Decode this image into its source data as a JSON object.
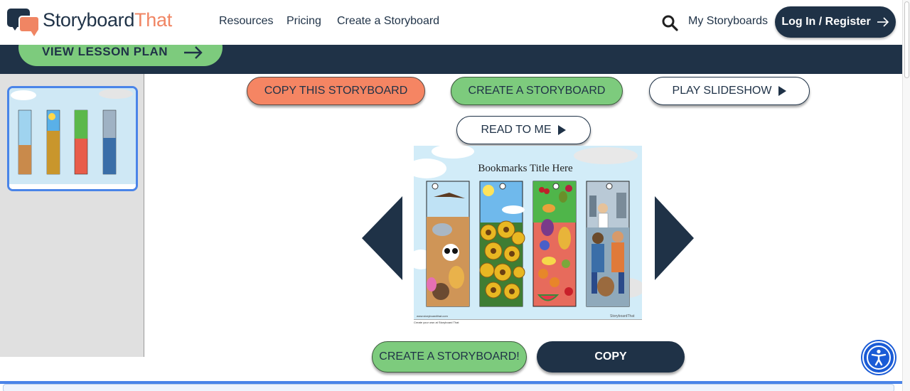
{
  "nav": {
    "logo_part1": "Storyboard",
    "logo_part2": "That",
    "links": [
      "Resources",
      "Pricing",
      "Create a Storyboard"
    ],
    "my_storyboards": "My Storyboards",
    "login": "Log In / Register"
  },
  "lesson": {
    "label": "VIEW LESSON PLAN"
  },
  "actions": {
    "copy_storyboard": "COPY THIS STORYBOARD",
    "create_storyboard": "CREATE A STORYBOARD",
    "play_slideshow": "PLAY SLIDESHOW",
    "read_to_me": "READ TO ME",
    "create_storyboard_bottom": "CREATE A STORYBOARD!",
    "copy": "COPY"
  },
  "storyboard": {
    "title": "Bookmarks Title Here",
    "footer_left": "www.storyboardthat.com",
    "footer_right": "StoryboardThat",
    "caption": "Create your own at Storyboard That"
  },
  "colors": {
    "navy": "#1f3247",
    "orange": "#f58563",
    "green": "#7dcb7d",
    "blue": "#4a84e8"
  },
  "icons": {
    "search": "magnifier",
    "login_arrow": "arrow-right",
    "accessibility": "accessibility-person"
  }
}
